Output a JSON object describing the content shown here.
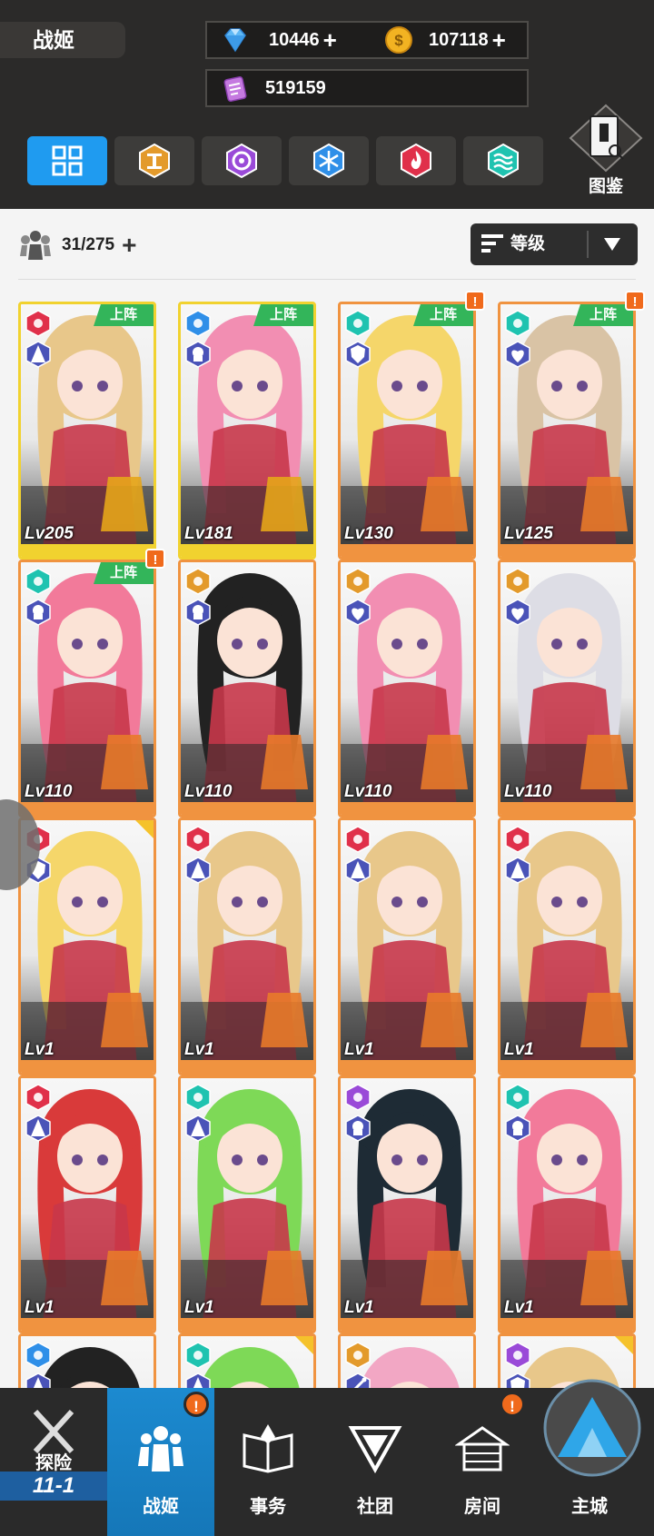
{
  "header": {
    "title": "战姬",
    "currency": {
      "gems": "10446",
      "coins": "107118",
      "tickets": "519159"
    },
    "atlas_label": "图鉴",
    "icons": {
      "gem": "diamond-icon",
      "coin": "coin-icon",
      "ticket": "clipboard-icon",
      "atlas": "atlas-book-icon"
    }
  },
  "filters": {
    "tabs": [
      {
        "name": "all",
        "icon": "grid-icon",
        "color": "#1f9bf0"
      },
      {
        "name": "earth",
        "icon": "pillar-element-icon",
        "color": "#e39a2b"
      },
      {
        "name": "void",
        "icon": "swirl-element-icon",
        "color": "#9a4ad8"
      },
      {
        "name": "ice",
        "icon": "snowflake-element-icon",
        "color": "#2f8fe8"
      },
      {
        "name": "fire",
        "icon": "flame-element-icon",
        "color": "#e0304a"
      },
      {
        "name": "water",
        "icon": "wave-element-icon",
        "color": "#1fc3b0"
      }
    ]
  },
  "roster": {
    "count": "31/275",
    "sort_label": "等级"
  },
  "cards": [
    {
      "level": "Lv205",
      "deployed": true,
      "deploy_label": "上阵",
      "element": "#e0304a",
      "role": "mage",
      "frame": "#f1d22f",
      "hair": "#e8c78a",
      "alert": false
    },
    {
      "level": "Lv181",
      "deployed": true,
      "deploy_label": "上阵",
      "element": "#2f8fe8",
      "role": "assassin",
      "frame": "#f1d22f",
      "hair": "#f28eb2",
      "alert": false
    },
    {
      "level": "Lv130",
      "deployed": true,
      "deploy_label": "上阵",
      "element": "#1fc3b0",
      "role": "tank",
      "frame": "#f09340",
      "hair": "#f5d66a",
      "alert": true
    },
    {
      "level": "Lv125",
      "deployed": true,
      "deploy_label": "上阵",
      "element": "#1fc3b0",
      "role": "healer",
      "frame": "#f09340",
      "hair": "#d9c3a5",
      "alert": true
    },
    {
      "level": "Lv110",
      "deployed": true,
      "deploy_label": "上阵",
      "element": "#1fc3b0",
      "role": "assassin",
      "frame": "#f09340",
      "hair": "#f27a9a",
      "alert": true
    },
    {
      "level": "Lv110",
      "deployed": false,
      "deploy_label": "",
      "element": "#e39a2b",
      "role": "assassin",
      "frame": "#f09340",
      "hair": "#222222",
      "alert": false
    },
    {
      "level": "Lv110",
      "deployed": false,
      "deploy_label": "",
      "element": "#e39a2b",
      "role": "healer",
      "frame": "#f09340",
      "hair": "#f28eb2",
      "alert": false
    },
    {
      "level": "Lv110",
      "deployed": false,
      "deploy_label": "",
      "element": "#e39a2b",
      "role": "healer",
      "frame": "#f09340",
      "hair": "#dddde5",
      "alert": false
    },
    {
      "level": "Lv1",
      "deployed": false,
      "deploy_label": "",
      "element": "#e0304a",
      "role": "tank",
      "frame": "#f09340",
      "hair": "#f5d66a",
      "alert": false,
      "corner": true
    },
    {
      "level": "Lv1",
      "deployed": false,
      "deploy_label": "",
      "element": "#e0304a",
      "role": "mage",
      "frame": "#f09340",
      "hair": "#e8c78a",
      "alert": false
    },
    {
      "level": "Lv1",
      "deployed": false,
      "deploy_label": "",
      "element": "#e0304a",
      "role": "mage",
      "frame": "#f09340",
      "hair": "#e8c78a",
      "alert": false
    },
    {
      "level": "Lv1",
      "deployed": false,
      "deploy_label": "",
      "element": "#e0304a",
      "role": "mage",
      "frame": "#f09340",
      "hair": "#e8c78a",
      "alert": false
    },
    {
      "level": "Lv1",
      "deployed": false,
      "deploy_label": "",
      "element": "#e0304a",
      "role": "mage",
      "frame": "#f09340",
      "hair": "#d93a3a",
      "alert": false
    },
    {
      "level": "Lv1",
      "deployed": false,
      "deploy_label": "",
      "element": "#1fc3b0",
      "role": "mage",
      "frame": "#f09340",
      "hair": "#7ed957",
      "alert": false
    },
    {
      "level": "Lv1",
      "deployed": false,
      "deploy_label": "",
      "element": "#9a4ad8",
      "role": "assassin",
      "frame": "#f09340",
      "hair": "#1e2b35",
      "alert": false
    },
    {
      "level": "Lv1",
      "deployed": false,
      "deploy_label": "",
      "element": "#1fc3b0",
      "role": "assassin",
      "frame": "#f09340",
      "hair": "#f27a9a",
      "alert": false
    },
    {
      "level": "",
      "deployed": false,
      "deploy_label": "",
      "element": "#2f8fe8",
      "role": "mage",
      "frame": "#f09340",
      "hair": "#222222",
      "alert": false
    },
    {
      "level": "",
      "deployed": false,
      "deploy_label": "",
      "element": "#1fc3b0",
      "role": "mage",
      "frame": "#f09340",
      "hair": "#7ed957",
      "alert": false,
      "corner": true
    },
    {
      "level": "",
      "deployed": false,
      "deploy_label": "",
      "element": "#e39a2b",
      "role": "ranged",
      "frame": "#f09340",
      "hair": "#f2a7c4",
      "alert": false
    },
    {
      "level": "",
      "deployed": false,
      "deploy_label": "",
      "element": "#9a4ad8",
      "role": "tank",
      "frame": "#f09340",
      "hair": "#e8c78a",
      "alert": false,
      "corner": true
    }
  ],
  "nav": {
    "items": [
      {
        "label": "探险",
        "icon": "crossed-swords-icon",
        "stage": "11-1"
      },
      {
        "label": "战姬",
        "icon": "group-icon",
        "alert": "!"
      },
      {
        "label": "事务",
        "icon": "open-book-icon"
      },
      {
        "label": "社团",
        "icon": "guild-emblem-icon"
      },
      {
        "label": "房间",
        "icon": "house-icon",
        "alert": "!"
      },
      {
        "label": "主城",
        "icon": "mountain-city-icon"
      }
    ],
    "active_color": "#1c8ad0"
  },
  "alerts": {
    "mark": "!"
  }
}
